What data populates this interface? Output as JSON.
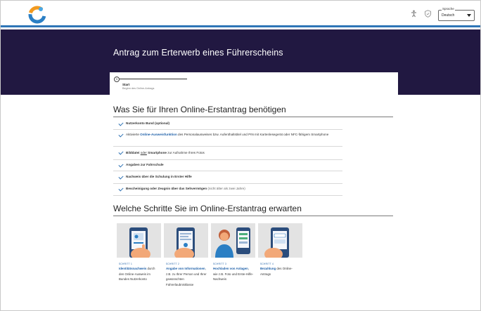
{
  "header": {
    "language_label": "Sprache",
    "language_value": "Deutsch",
    "icons": [
      "brand-logo-icon",
      "accessibility-icon",
      "shield-icon",
      "chevron-down-icon"
    ]
  },
  "banner": {
    "title": "Antrag zum Erterwerb eines Führerscheins"
  },
  "stepper": {
    "number": "1",
    "title": "Start",
    "subtitle": "Beginn des Online-Antrags"
  },
  "requirements": {
    "heading": "Was Sie für Ihren Online-Erstantrag benötigen",
    "items": [
      {
        "bold": "Nutzerkonto Bund (optional)"
      },
      {
        "pre": "Aktivierte ",
        "link": "Online-Ausweisfunktion",
        "post": " des Personalausweises bzw. Aufenthaltstitel und PIN mit Kartenlesegerät oder NFC-fähigem Smartphone"
      },
      {
        "bold": "Bilddatei",
        "mid": " ",
        "under": "oder",
        "bold2": " Smartphone",
        "post": " zur Aufnahme Ihres Fotos"
      },
      {
        "bold": "Angaben zur Fahrschule"
      },
      {
        "bold": "Nachweis über die Schulung in Erster Hilfe"
      },
      {
        "bold": "Bescheinigung oder Zeugnis über das Sehvermögen",
        "post": " (nicht älter als zwei Jahre)"
      }
    ]
  },
  "steps": {
    "heading": "Welche Schritte Sie im Online-Erstantrag erwarten",
    "cards": [
      {
        "step": "SCHRITT 1",
        "link": "Identitätsnachweis",
        "post": " durch den Online-Ausweis im Bundes Nutzerkonto"
      },
      {
        "step": "SCHRITT 2",
        "link": "Angabe von Informationen",
        "post": ", z.B. zu Ihrer Person und Ihrer gewünschten Fahrerlaubnisklasse"
      },
      {
        "step": "SCHRITT 3",
        "link": "Hochladen von Anlagen",
        "post": ", wie z.B. Foto und Erste-Hilfe-Nachweis"
      },
      {
        "step": "SCHRITT 4",
        "link": "Bezahlung",
        "post": " des Online-Antrags"
      }
    ]
  },
  "colors": {
    "banner": "#211841",
    "accent": "#2f76b7",
    "link": "#1d5fa8",
    "card_image_bg": "#e3e3e3"
  }
}
